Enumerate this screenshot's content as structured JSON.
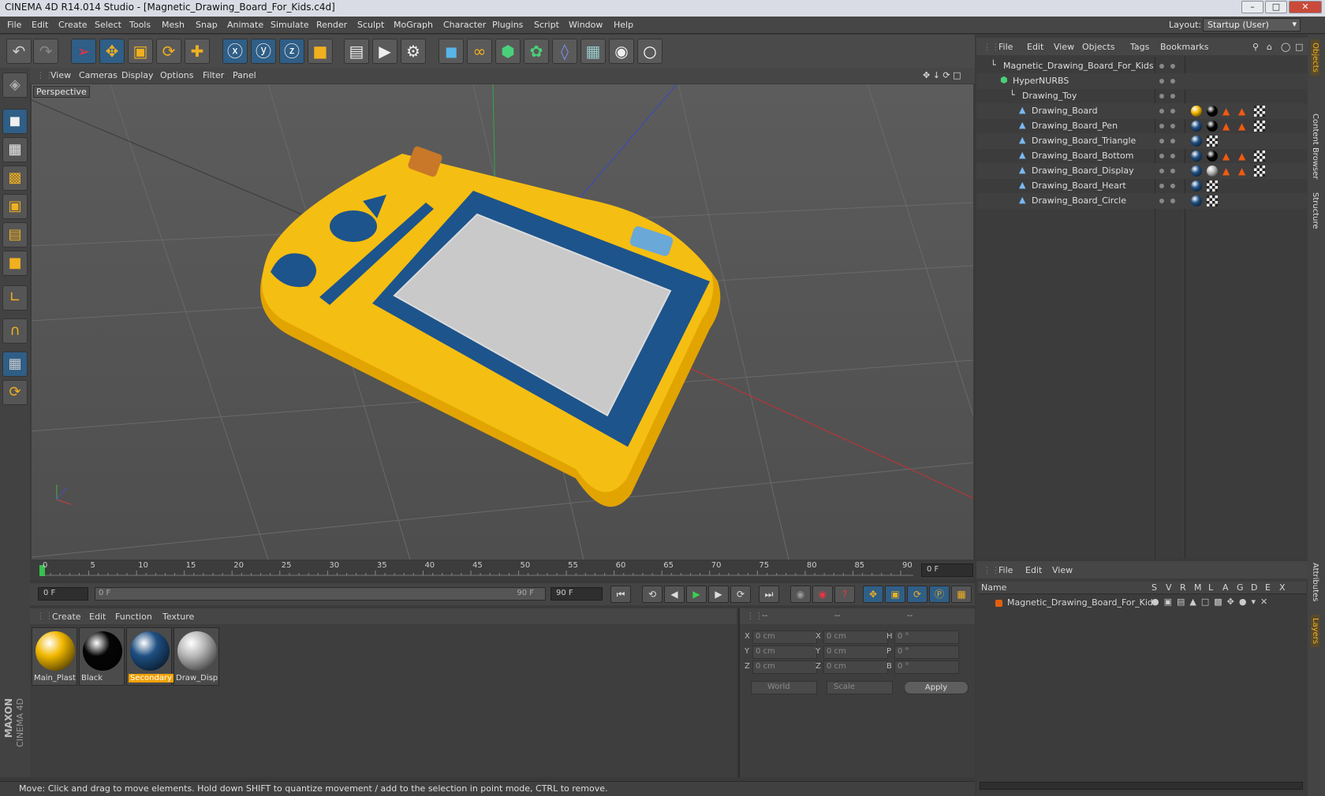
{
  "window": {
    "title": "CINEMA 4D R14.014 Studio - [Magnetic_Drawing_Board_For_Kids.c4d]"
  },
  "menu": [
    "File",
    "Edit",
    "Create",
    "Select",
    "Tools",
    "Mesh",
    "Snap",
    "Animate",
    "Simulate",
    "Render",
    "Sculpt",
    "MoGraph",
    "Character",
    "Plugins",
    "Script",
    "Window",
    "Help"
  ],
  "layout": {
    "label": "Layout:",
    "value": "Startup (User)"
  },
  "viewport": {
    "menu": [
      "View",
      "Cameras",
      "Display",
      "Options",
      "Filter",
      "Panel"
    ],
    "label": "Perspective"
  },
  "timeline": {
    "ticks": [
      "0",
      "5",
      "10",
      "15",
      "20",
      "25",
      "30",
      "35",
      "40",
      "45",
      "50",
      "55",
      "60",
      "65",
      "70",
      "75",
      "80",
      "85",
      "90"
    ],
    "current_frame": "0 F",
    "start_field": "0 F",
    "slider_left": "0 F",
    "slider_right": "90 F",
    "end_field": "90 F"
  },
  "materials": {
    "menu": [
      "Create",
      "Edit",
      "Function",
      "Texture"
    ],
    "items": [
      {
        "name": "Main_Plast",
        "color": "#f2b800"
      },
      {
        "name": "Black",
        "color": "#050505"
      },
      {
        "name": "Secondary",
        "color": "#1e4f82"
      },
      {
        "name": "Draw_Disp",
        "color": "#b8b8b8"
      }
    ]
  },
  "coordinates": {
    "header": [
      "--",
      "--",
      "--"
    ],
    "rows": [
      {
        "a": "X",
        "av": "0 cm",
        "b": "X",
        "bv": "0 cm",
        "c": "H",
        "cv": "0 °"
      },
      {
        "a": "Y",
        "av": "0 cm",
        "b": "Y",
        "bv": "0 cm",
        "c": "P",
        "cv": "0 °"
      },
      {
        "a": "Z",
        "av": "0 cm",
        "b": "Z",
        "bv": "0 cm",
        "c": "B",
        "cv": "0 °"
      }
    ],
    "world": "World",
    "scale": "Scale",
    "apply": "Apply"
  },
  "objects": {
    "menu": [
      "File",
      "Edit",
      "View",
      "Objects",
      "Tags",
      "Bookmarks"
    ],
    "items": [
      {
        "name": "Magnetic_Drawing_Board_For_Kids",
        "depth": 0
      },
      {
        "name": "HyperNURBS",
        "depth": 1
      },
      {
        "name": "Drawing_Toy",
        "depth": 2
      },
      {
        "name": "Drawing_Board",
        "depth": 3
      },
      {
        "name": "Drawing_Board_Pen",
        "depth": 3
      },
      {
        "name": "Drawing_Board_Triangle",
        "depth": 3
      },
      {
        "name": "Drawing_Board_Bottom",
        "depth": 3
      },
      {
        "name": "Drawing_Board_Display",
        "depth": 3
      },
      {
        "name": "Drawing_Board_Heart",
        "depth": 3
      },
      {
        "name": "Drawing_Board_Circle",
        "depth": 3
      }
    ]
  },
  "layers": {
    "menu": [
      "File",
      "Edit",
      "View"
    ],
    "header": {
      "name": "Name",
      "cols": [
        "S",
        "V",
        "R",
        "M",
        "L",
        "A",
        "G",
        "D",
        "E",
        "X"
      ]
    },
    "row": "Magnetic_Drawing_Board_For_Kids"
  },
  "right_tabs": [
    "Objects",
    "Content Browser",
    "Structure",
    "Attributes",
    "Layers"
  ],
  "status": "Move: Click and drag to move elements. Hold down SHIFT to quantize movement / add to the selection in point mode, CTRL to remove.",
  "brand": {
    "line1": "MAXON",
    "line2": "CINEMA 4D"
  }
}
